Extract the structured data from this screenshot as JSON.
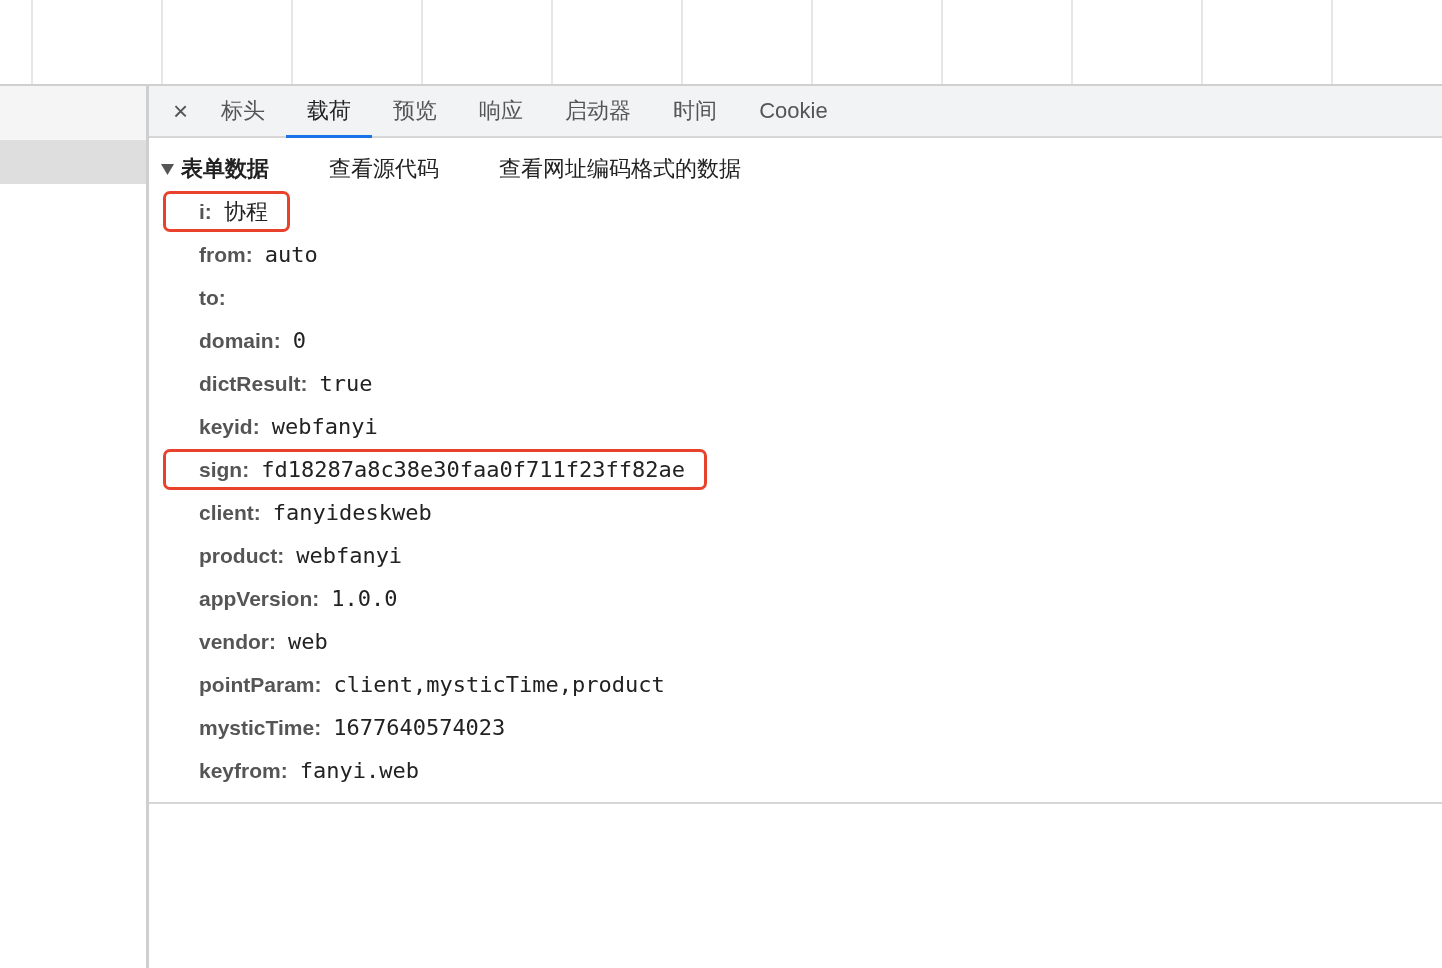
{
  "tabs": [
    {
      "label": "标头",
      "selected": false
    },
    {
      "label": "载荷",
      "selected": true
    },
    {
      "label": "预览",
      "selected": false
    },
    {
      "label": "响应",
      "selected": false
    },
    {
      "label": "启动器",
      "selected": false
    },
    {
      "label": "时间",
      "selected": false
    },
    {
      "label": "Cookie",
      "selected": false
    }
  ],
  "close_label": "×",
  "section": {
    "title": "表单数据",
    "expanded": true,
    "actions": [
      "查看源代码",
      "查看网址编码格式的数据"
    ]
  },
  "params": [
    {
      "key": "i:",
      "value": "协程",
      "highlighted": true
    },
    {
      "key": "from:",
      "value": "auto",
      "highlighted": false
    },
    {
      "key": "to:",
      "highlighted": false
    },
    {
      "key": "domain:",
      "value": "0",
      "highlighted": false
    },
    {
      "key": "dictResult:",
      "value": "true",
      "highlighted": false
    },
    {
      "key": "keyid:",
      "value": "webfanyi",
      "highlighted": false
    },
    {
      "key": "sign:",
      "value": "fd18287a8c38e30faa0f711f23ff82ae",
      "highlighted": true
    },
    {
      "key": "client:",
      "value": "fanyideskweb",
      "highlighted": false
    },
    {
      "key": "product:",
      "value": "webfanyi",
      "highlighted": false
    },
    {
      "key": "appVersion:",
      "value": "1.0.0",
      "highlighted": false
    },
    {
      "key": "vendor:",
      "value": "web",
      "highlighted": false
    },
    {
      "key": "pointParam:",
      "value": "client,mysticTime,product",
      "highlighted": false
    },
    {
      "key": "mysticTime:",
      "value": "1677640574023",
      "highlighted": false
    },
    {
      "key": "keyfrom:",
      "value": "fanyi.web",
      "highlighted": false
    }
  ]
}
